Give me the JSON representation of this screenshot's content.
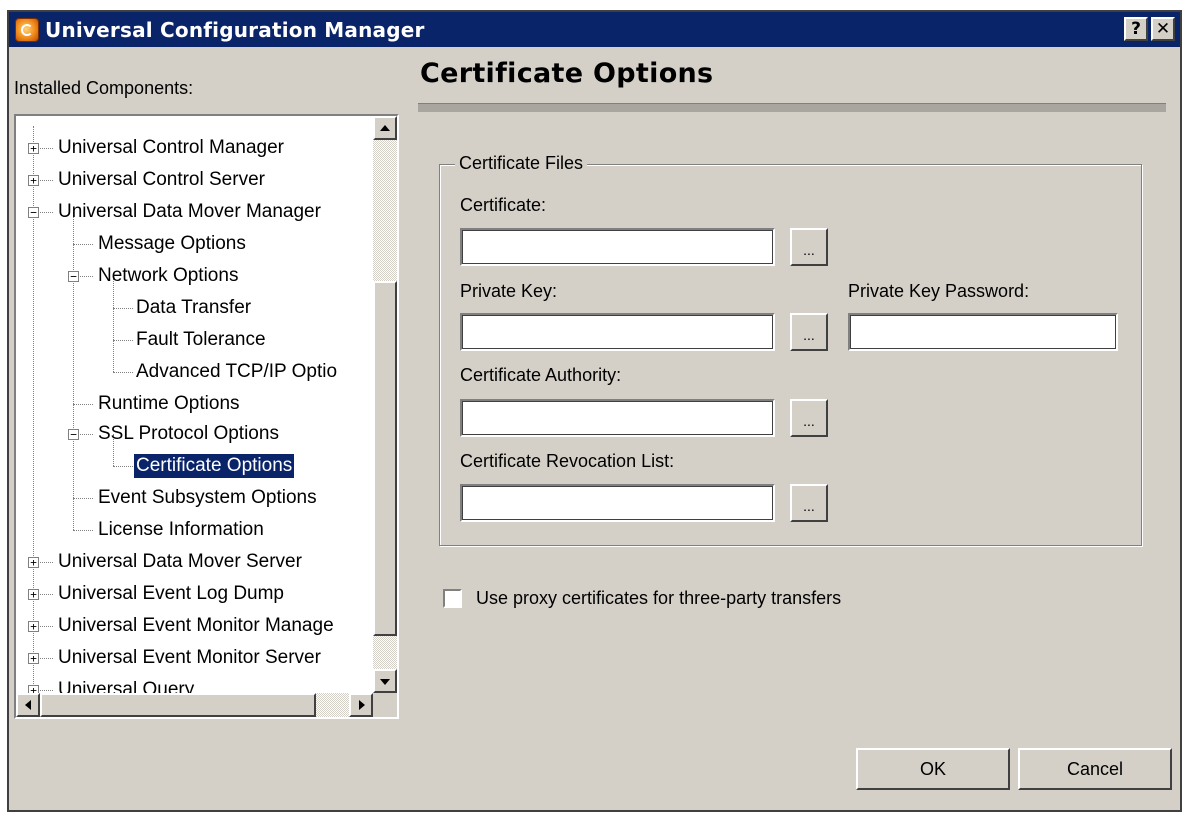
{
  "window": {
    "title": "Universal Configuration Manager",
    "help_label": "?",
    "close_label": "✕"
  },
  "sidebar": {
    "label": "Installed Components:",
    "items": [
      {
        "label": "Universal Control Manager",
        "expander": "+"
      },
      {
        "label": "Universal Control Server",
        "expander": "+"
      },
      {
        "label": "Universal Data Mover Manager",
        "expander": "−"
      },
      {
        "label": "Message Options"
      },
      {
        "label": "Network Options",
        "expander": "−"
      },
      {
        "label": "Data Transfer"
      },
      {
        "label": "Fault Tolerance"
      },
      {
        "label": "Advanced TCP/IP Optio"
      },
      {
        "label": "Runtime Options"
      },
      {
        "label": "SSL Protocol Options",
        "expander": "−"
      },
      {
        "label": "Certificate Options",
        "selected": true
      },
      {
        "label": "Event Subsystem Options"
      },
      {
        "label": "License Information"
      },
      {
        "label": "Universal Data Mover Server",
        "expander": "+"
      },
      {
        "label": "Universal Event Log Dump",
        "expander": "+"
      },
      {
        "label": "Universal Event Monitor Manage",
        "expander": "+"
      },
      {
        "label": "Universal Event Monitor Server",
        "expander": "+"
      },
      {
        "label": "Universal Query",
        "expander": "+"
      }
    ]
  },
  "main": {
    "title": "Certificate Options",
    "group_label": "Certificate Files",
    "certificate_label": "Certificate:",
    "certificate_value": "",
    "private_key_label": "Private Key:",
    "private_key_value": "",
    "private_key_password_label": "Private Key Password:",
    "private_key_password_value": "",
    "certificate_authority_label": "Certificate Authority:",
    "certificate_authority_value": "",
    "revocation_list_label": "Certificate Revocation List:",
    "revocation_list_value": "",
    "browse_label": "...",
    "proxy_checkbox_label": "Use proxy certificates for three-party transfers",
    "proxy_checked": false
  },
  "footer": {
    "ok_label": "OK",
    "cancel_label": "Cancel"
  }
}
